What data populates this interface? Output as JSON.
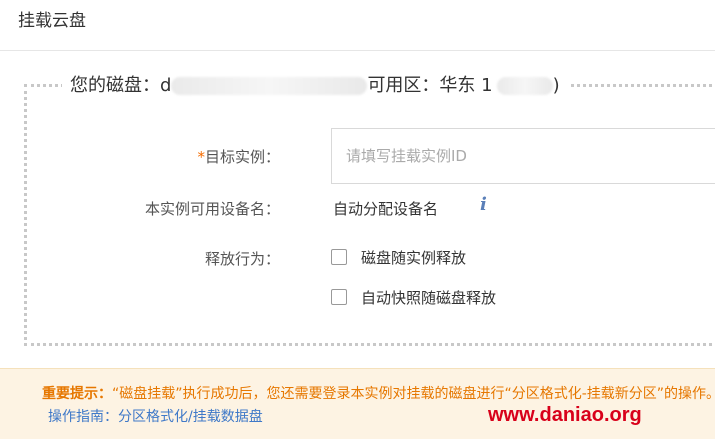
{
  "header": {
    "title": "挂载云盘"
  },
  "disk": {
    "label": "您的磁盘：",
    "id_prefix": "d",
    "zone_label": "可用区：华东 1",
    "zone_suffix": ")"
  },
  "form": {
    "target_instance": {
      "required_mark": "*",
      "label": "目标实例：",
      "placeholder": "请填写挂载实例ID"
    },
    "device_name": {
      "label": "本实例可用设备名：",
      "value": "自动分配设备名",
      "info_icon": "i"
    },
    "release": {
      "label": "释放行为：",
      "options": [
        {
          "label": "磁盘随实例释放",
          "checked": false
        },
        {
          "label": "自动快照随磁盘释放",
          "checked": false
        }
      ]
    }
  },
  "notice": {
    "prefix": "重要提示：",
    "body": "“磁盘挂载”执行成功后，您还需要登录本实例对挂载的磁盘进行“分区格式化-挂载新分区”的操作。",
    "guide_label": "操作指南：分区格式化/挂载数据盘"
  },
  "watermark": "www.daniao.org",
  "colors": {
    "accent_orange": "#e67700",
    "link_blue": "#3f79c8",
    "required_orange": "#f56c00",
    "watermark_red": "#d8001a",
    "notice_bg": "#fdf3e3"
  }
}
